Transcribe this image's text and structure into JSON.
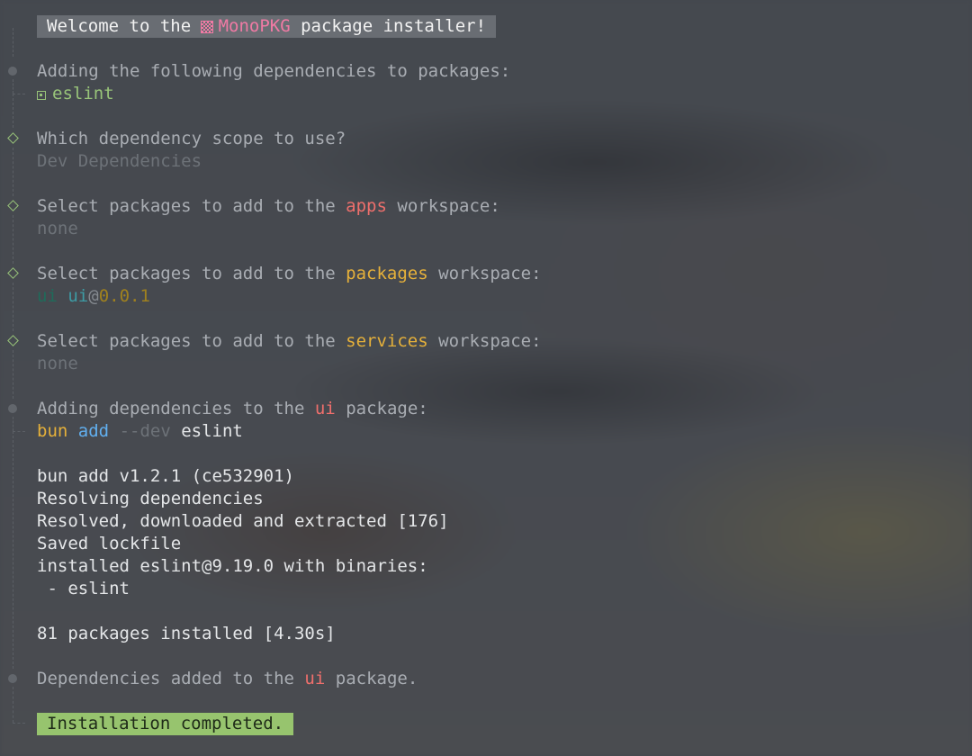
{
  "welcome": {
    "prefix": "Welcome to the ",
    "icon": "package-icon",
    "brand": "MonoPKG",
    "suffix": " package installer!"
  },
  "adding": {
    "title": "Adding the following dependencies to packages:",
    "dependency": "eslint",
    "icon": "box-icon"
  },
  "scope": {
    "question": "Which dependency scope to use?",
    "answer": "Dev Dependencies"
  },
  "apps": {
    "prefix": "Select packages to add to the ",
    "workspace": "apps",
    "suffix": " workspace:",
    "answer": "none"
  },
  "packages": {
    "prefix": "Select packages to add to the ",
    "workspace": "packages",
    "suffix": " workspace:",
    "pkg_short": "ui",
    "pkg_name": "ui",
    "at": "@",
    "version": "0.0.1"
  },
  "services": {
    "prefix": "Select packages to add to the ",
    "workspace": "services",
    "suffix": " workspace:",
    "answer": "none"
  },
  "adding_ui": {
    "prefix": "Adding dependencies to the ",
    "pkg": "ui",
    "suffix": " package:"
  },
  "command": {
    "bin": "bun",
    "sub": "add",
    "flag": "--dev",
    "arg": "eslint"
  },
  "output": [
    "bun add v1.2.1 (ce532901)",
    "Resolving dependencies",
    "Resolved, downloaded and extracted [176]",
    "Saved lockfile",
    "installed eslint@9.19.0 with binaries:",
    " - eslint",
    "",
    "81 packages installed [4.30s]"
  ],
  "added": {
    "prefix": "Dependencies added to the ",
    "pkg": "ui",
    "suffix": " package."
  },
  "completed": "Installation completed.",
  "colors": {
    "background": "#44484e",
    "accent_green": "#98c379",
    "workspace_red": "#ef6f6c",
    "workspace_yellow": "#e5b03a",
    "brand_pink": "#f07aa4"
  }
}
